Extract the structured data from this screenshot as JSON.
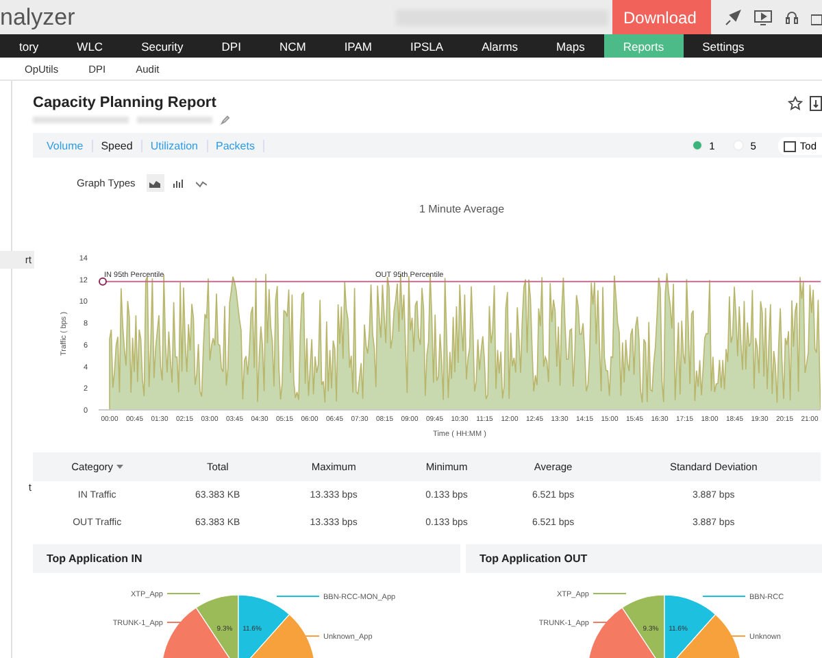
{
  "header": {
    "logo": "nalyzer",
    "download": "Download"
  },
  "nav": [
    {
      "label": "tory",
      "selected": false
    },
    {
      "label": "WLC",
      "selected": false
    },
    {
      "label": "Security",
      "selected": false
    },
    {
      "label": "DPI",
      "selected": false
    },
    {
      "label": "NCM",
      "selected": false
    },
    {
      "label": "IPAM",
      "selected": false
    },
    {
      "label": "IPSLA",
      "selected": false
    },
    {
      "label": "Alarms",
      "selected": false
    },
    {
      "label": "Maps",
      "selected": false
    },
    {
      "label": "Reports",
      "selected": true
    },
    {
      "label": "Settings",
      "selected": false
    }
  ],
  "subnav": [
    "OpUtils",
    "DPI",
    "Audit"
  ],
  "sidebar": [
    {
      "label": "rt",
      "selected": true
    },
    {
      "label": "t",
      "selected": false
    }
  ],
  "report": {
    "title": "Capacity Planning Report",
    "tabs": [
      {
        "label": "Volume",
        "selected": false
      },
      {
        "label": "Speed",
        "selected": true
      },
      {
        "label": "Utilization",
        "selected": false
      },
      {
        "label": "Packets",
        "selected": false
      }
    ],
    "legend": [
      {
        "label": "1",
        "color": "#3bb37a"
      },
      {
        "label": "5",
        "color": "#ffffff"
      }
    ],
    "date": "Tod",
    "graph_types_label": "Graph Types",
    "chart": {
      "title": "1 Minute Average",
      "ylabel": "Traffic ( bps )",
      "xlabel": "Time ( HH:MM )",
      "yticks": [
        "14",
        "12",
        "10",
        "8",
        "6",
        "4",
        "2",
        "0"
      ],
      "xticks": [
        "00:00",
        "00:45",
        "01:30",
        "02:15",
        "03:00",
        "03:45",
        "04:30",
        "05:15",
        "06:00",
        "06:45",
        "07:30",
        "08:15",
        "09:00",
        "09:45",
        "10:30",
        "11:15",
        "12:00",
        "12:45",
        "13:30",
        "14:15",
        "15:00",
        "15:45",
        "16:30",
        "17:15",
        "18:00",
        "18:45",
        "19:30",
        "20:15",
        "21:00"
      ],
      "markers": [
        "IN 95th Percentile",
        "OUT 95th Percentile"
      ]
    },
    "table": {
      "columns": [
        "Category",
        "Total",
        "Maximum",
        "Minimum",
        "Average",
        "Standard Deviation"
      ],
      "rows": [
        [
          "IN Traffic",
          "63.383 KB",
          "13.333 bps",
          "0.133 bps",
          "6.521 bps",
          "3.887 bps"
        ],
        [
          "OUT Traffic",
          "63.383 KB",
          "13.333 bps",
          "0.133 bps",
          "6.521 bps",
          "3.887 bps"
        ]
      ]
    },
    "panels": [
      {
        "title": "Top Application IN",
        "slices": [
          {
            "label": "XTP_App",
            "color": "#9bbb59",
            "pct": "9.3%"
          },
          {
            "label": "TRUNK-1_App",
            "color": "#f47b61"
          },
          {
            "label": "BBN-RCC-MON_App",
            "color": "#1ec0e0",
            "pct": "11.6%"
          },
          {
            "label": "Unknown_App",
            "color": "#f6a13c"
          }
        ]
      },
      {
        "title": "Top Application OUT",
        "slices": [
          {
            "label": "XTP_App",
            "color": "#9bbb59",
            "pct": "9.3%"
          },
          {
            "label": "TRUNK-1_App",
            "color": "#f47b61"
          },
          {
            "label": "BBN-RCC",
            "color": "#1ec0e0",
            "pct": "11.6%"
          },
          {
            "label": "Unknown",
            "color": "#f6a13c"
          }
        ]
      }
    ]
  }
}
